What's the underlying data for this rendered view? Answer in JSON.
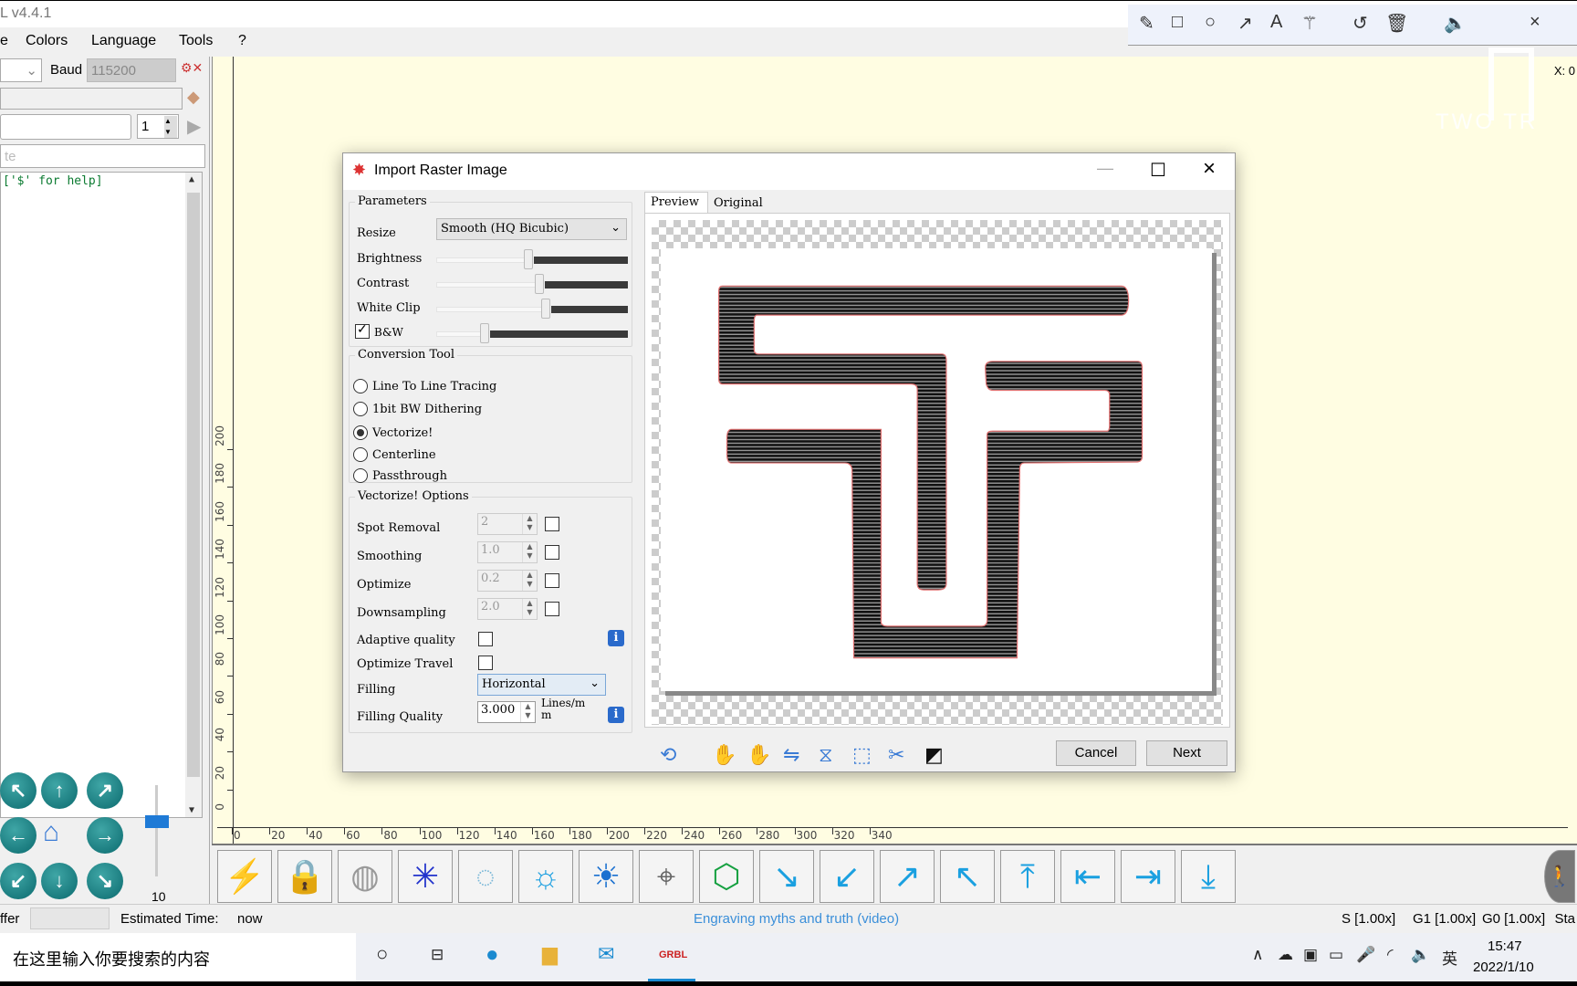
{
  "window": {
    "title": "L v4.4.1"
  },
  "menu": [
    "e",
    "Colors",
    "Language",
    "Tools",
    "?"
  ],
  "left_panel": {
    "baud_label": "Baud",
    "baud_value": "115200",
    "line_count": "1",
    "console_placeholder": "te",
    "console_text": "['$' for help]",
    "jog_speed": "10"
  },
  "canvas": {
    "x_ticks": [
      "0",
      "20",
      "40",
      "60",
      "80",
      "100",
      "120",
      "140",
      "160",
      "180",
      "200",
      "220",
      "240",
      "260",
      "280",
      "300",
      "320",
      "340"
    ],
    "y_ticks": [
      "0",
      "20",
      "40",
      "60",
      "80",
      "100",
      "120",
      "140",
      "160",
      "180",
      "200"
    ],
    "coord_readout": "X: 0",
    "watermark": "TWO TR",
    "background": "#fffde2"
  },
  "toolbar_buttons": [
    "lightning-icon",
    "lock-icon",
    "globe-icon",
    "laser-icon",
    "sun-dim-icon",
    "sun-medium-icon",
    "sun-bright-icon",
    "map-pin-icon",
    "hexagon-icon",
    "arrow-down-right-icon",
    "arrow-down-left-icon",
    "arrow-up-right-icon",
    "arrow-up-left-icon",
    "arrow-up-icon",
    "arrow-left-icon",
    "arrow-right-icon",
    "arrow-down-icon"
  ],
  "status": {
    "buffer_label": "ffer",
    "estimated_label": "Estimated Time:",
    "estimated_value": "now",
    "link": "Engraving myths and truth (video)",
    "s_override": "S [1.00x]",
    "g1_override": "G1 [1.00x]",
    "g0_override": "G0 [1.00x]",
    "state": "Sta",
    "link_color": "#3b8fd9"
  },
  "annotation_toolbar": [
    "pencil-icon",
    "rectangle-icon",
    "circle-icon",
    "arrow-icon",
    "text-icon",
    "magic-wand-icon",
    "undo-icon",
    "trash-icon",
    "speaker-icon",
    "close-icon"
  ],
  "taskbar": {
    "search_placeholder": "在这里输入你要搜索的内容",
    "time": "15:47",
    "date": "2022/1/10",
    "ime": "英"
  },
  "dialog": {
    "title": "Import Raster Image",
    "parameters": {
      "legend": "Parameters",
      "resize_label": "Resize",
      "resize_value": "Smooth (HQ Bicubic)",
      "brightness_label": "Brightness",
      "brightness": 0.48,
      "contrast_label": "Contrast",
      "contrast": 0.54,
      "white_clip_label": "White Clip",
      "white_clip": 0.57,
      "bw_label": "B&W",
      "bw_checked": true,
      "bw": 0.25
    },
    "conversion": {
      "legend": "Conversion Tool",
      "options": [
        "Line To Line Tracing",
        "1bit BW Dithering",
        "Vectorize!",
        "Centerline",
        "Passthrough"
      ],
      "selected": "Vectorize!"
    },
    "vectorize": {
      "legend": "Vectorize! Options",
      "spot_removal_label": "Spot Removal",
      "spot_removal": "2",
      "smoothing_label": "Smoothing",
      "smoothing": "1.0",
      "optimize_label": "Optimize",
      "optimize": "0.2",
      "downsampling_label": "Downsampling",
      "downsampling": "2.0",
      "adaptive_label": "Adaptive quality",
      "optimize_travel_label": "Optimize Travel",
      "filling_label": "Filling",
      "filling_value": "Horizontal",
      "filling_quality_label": "Filling Quality",
      "filling_quality": "3.000",
      "filling_quality_unit": "Lines/m m"
    },
    "tabs": [
      "Preview",
      "Original"
    ],
    "active_tab": "Preview",
    "tool_icons": [
      "rotate-icon",
      "flip-horizontal-icon",
      "flip-vertical-icon",
      "mirror-icon",
      "mirror-vertical-icon",
      "crop-icon",
      "auto-trim-icon",
      "invert-icon"
    ],
    "cancel": "Cancel",
    "next": "Next"
  }
}
